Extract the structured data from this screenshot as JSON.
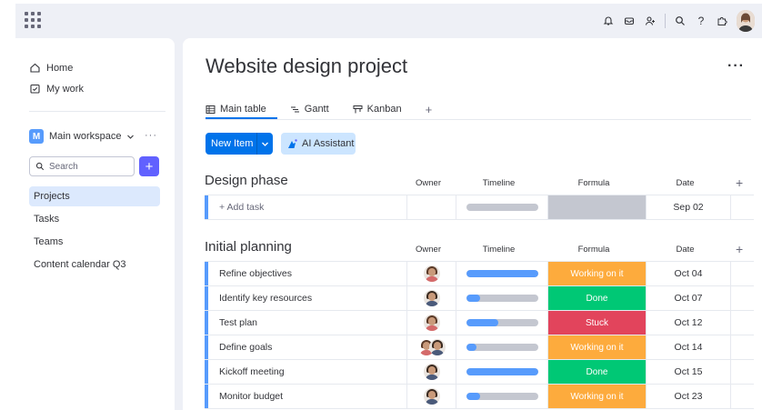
{
  "nav": {
    "home": "Home",
    "my_work": "My work"
  },
  "workspace": {
    "badge": "M",
    "name": "Main workspace"
  },
  "search": {
    "placeholder": "Search"
  },
  "boards": [
    "Projects",
    "Tasks",
    "Teams",
    "Content calendar Q3"
  ],
  "project": {
    "title": "Website design project"
  },
  "tabs": [
    {
      "label": "Main table",
      "icon": "table-icon"
    },
    {
      "label": "Gantt",
      "icon": "gantt-icon"
    },
    {
      "label": "Kanban",
      "icon": "kanban-icon"
    }
  ],
  "toolbar": {
    "new_item": "New Item",
    "ai_assistant": "AI Assistant"
  },
  "columns": {
    "owner": "Owner",
    "timeline": "Timeline",
    "formula": "Formula",
    "date": "Date"
  },
  "groups": [
    {
      "title": "Design phase",
      "color": "#579bfc",
      "rows": [
        {
          "name": "+ Add task",
          "owner": "",
          "timeline": 0,
          "formula": "",
          "formula_color": "#c4c7d0",
          "date": "Sep 02"
        }
      ]
    },
    {
      "title": "Initial planning",
      "color": "#579bfc",
      "rows": [
        {
          "name": "Refine objectives",
          "owner": "woman",
          "timeline": 1.0,
          "formula": "Working on it",
          "formula_color": "#fdab3d",
          "date": "Oct 04"
        },
        {
          "name": "Identify key resources",
          "owner": "man",
          "timeline": 0.2,
          "formula": "Done",
          "formula_color": "#00c875",
          "date": "Oct 07"
        },
        {
          "name": "Test plan",
          "owner": "woman",
          "timeline": 0.45,
          "formula": "Stuck",
          "formula_color": "#e2445c",
          "date": "Oct 12"
        },
        {
          "name": "Define goals",
          "owner": "pair",
          "timeline": 0.15,
          "formula": "Working on it",
          "formula_color": "#fdab3d",
          "date": "Oct 14"
        },
        {
          "name": "Kickoff meeting",
          "owner": "man",
          "timeline": 1.0,
          "formula": "Done",
          "formula_color": "#00c875",
          "date": "Oct 15"
        },
        {
          "name": "Monitor budget",
          "owner": "man",
          "timeline": 0.2,
          "formula": "Working on it",
          "formula_color": "#fdab3d",
          "date": "Oct 23"
        }
      ]
    }
  ]
}
